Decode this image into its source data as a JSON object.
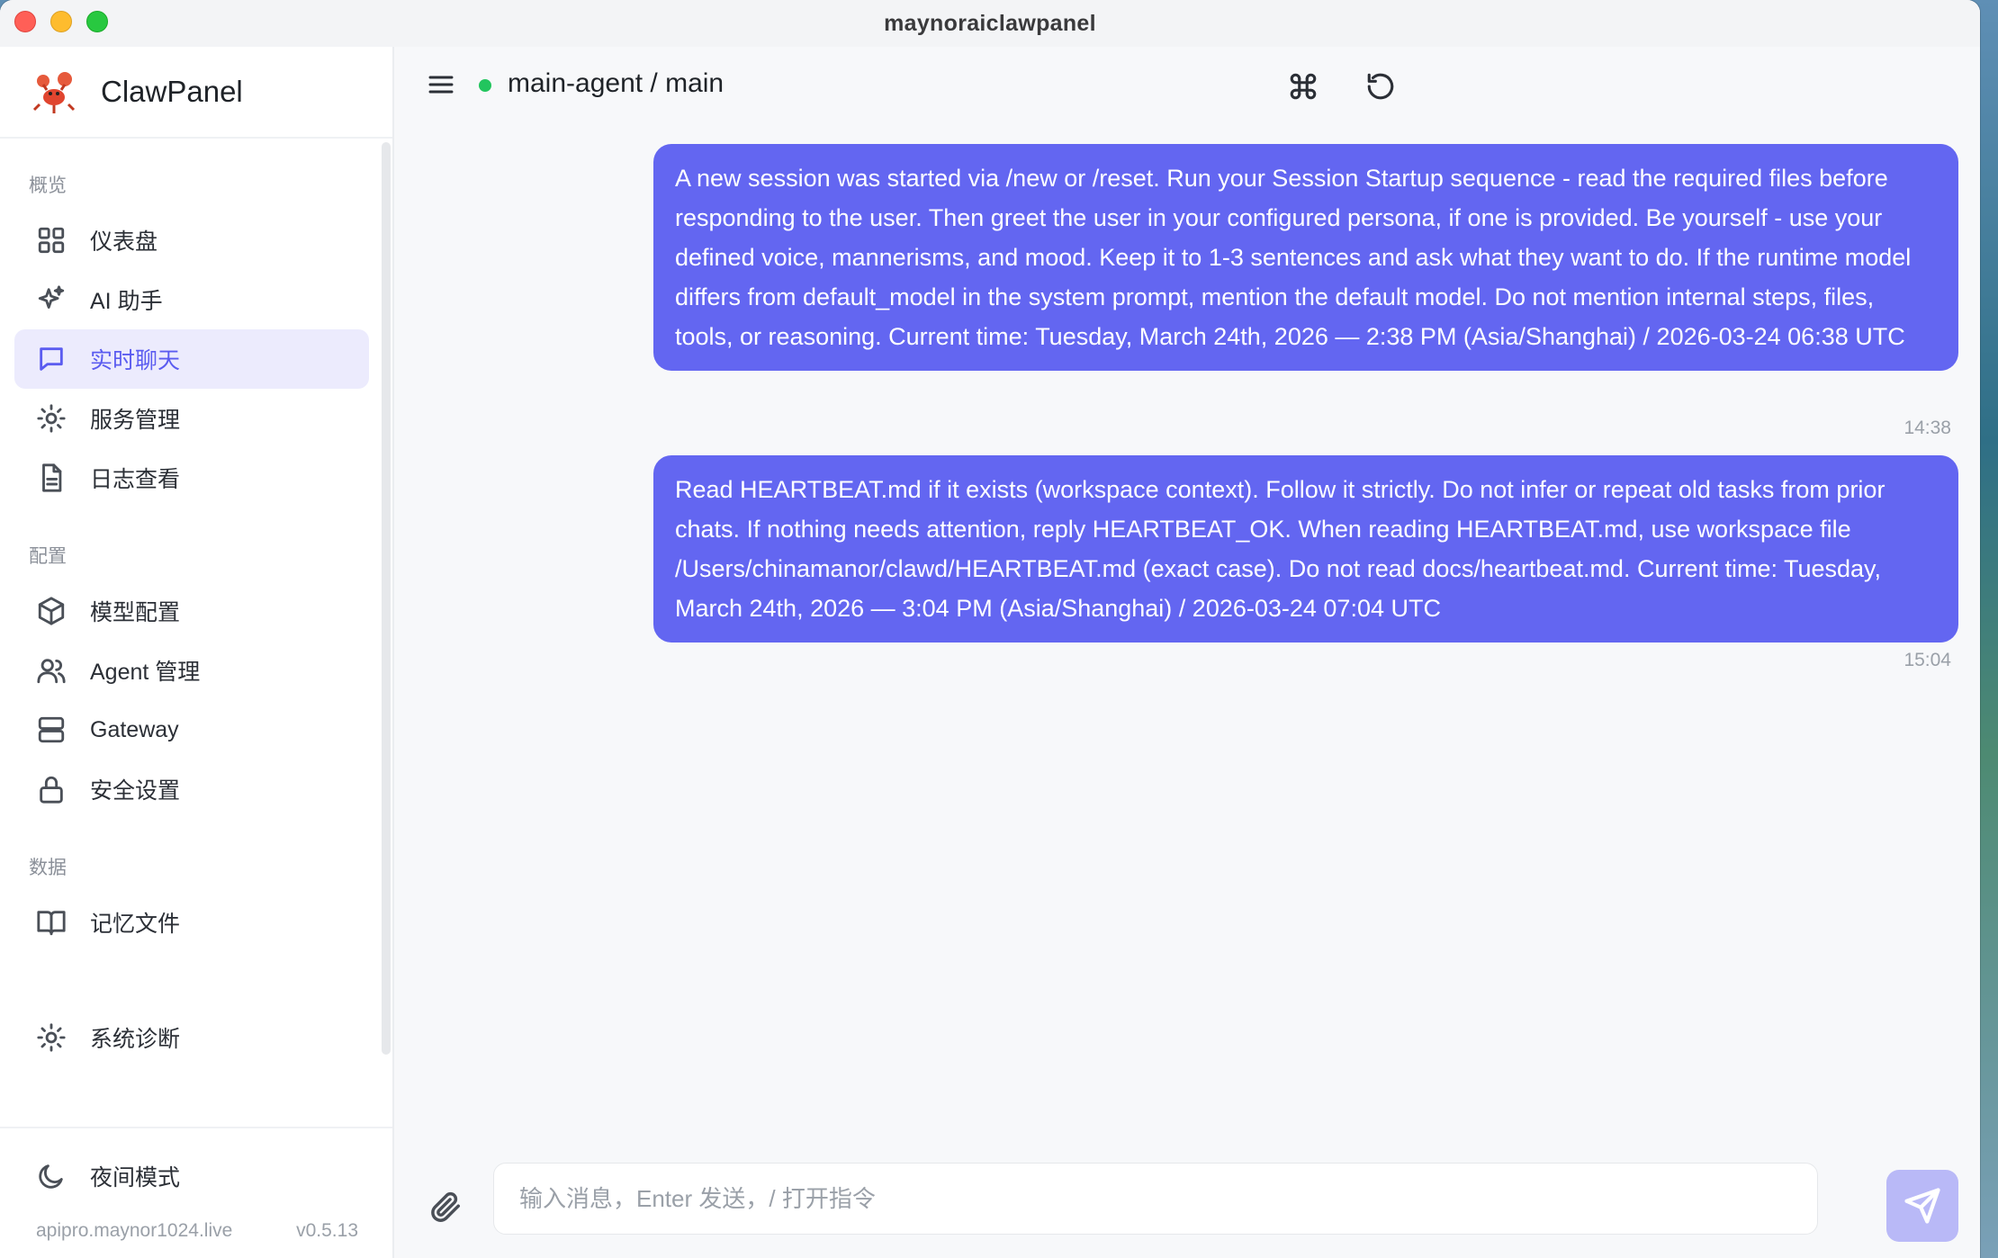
{
  "window": {
    "title": "maynoraiclawpanel"
  },
  "brand": {
    "name": "ClawPanel",
    "logo": "lobster-logo"
  },
  "sidebar": {
    "sections": [
      {
        "label": "概览",
        "items": [
          {
            "label": "仪表盘",
            "icon": "grid-icon"
          },
          {
            "label": "AI 助手",
            "icon": "sparkles-icon"
          },
          {
            "label": "实时聊天",
            "icon": "chat-bubble-icon",
            "active": true
          },
          {
            "label": "服务管理",
            "icon": "sun-gear-icon"
          },
          {
            "label": "日志查看",
            "icon": "document-icon"
          }
        ]
      },
      {
        "label": "配置",
        "items": [
          {
            "label": "模型配置",
            "icon": "cube-icon"
          },
          {
            "label": "Agent 管理",
            "icon": "users-icon"
          },
          {
            "label": "Gateway",
            "icon": "server-icon"
          },
          {
            "label": "安全设置",
            "icon": "lock-icon"
          }
        ]
      },
      {
        "label": "数据",
        "items": [
          {
            "label": "记忆文件",
            "icon": "book-icon"
          }
        ]
      }
    ],
    "diagnostics": {
      "label": "系统诊断",
      "icon": "sun-gear-icon"
    },
    "night_mode": {
      "label": "夜间模式",
      "icon": "moon-icon"
    },
    "footer": {
      "host": "apipro.maynor1024.live",
      "version": "v0.5.13"
    }
  },
  "chat": {
    "session_title": "main-agent / main",
    "status_color": "#22c55e",
    "messages": [
      {
        "role": "user",
        "text": "A new session was started via /new or /reset. Run your Session Startup sequence - read the required files before responding to the user. Then greet the user in your configured persona, if one is provided. Be yourself - use your defined voice, mannerisms, and mood. Keep it to 1-3 sentences and ask what they want to do. If the runtime model differs from default_model in the system prompt, mention the default model. Do not mention internal steps, files, tools, or reasoning. Current time: Tuesday, March 24th, 2026 — 2:38 PM (Asia/Shanghai) / 2026-03-24 06:38 UTC",
        "time": "14:38"
      },
      {
        "role": "user",
        "text": "Read HEARTBEAT.md if it exists (workspace context). Follow it strictly. Do not infer or repeat old tasks from prior chats. If nothing needs attention, reply HEARTBEAT_OK. When reading HEARTBEAT.md, use workspace file /Users/chinamanor/clawd/HEARTBEAT.md (exact case). Do not read docs/heartbeat.md. Current time: Tuesday, March 24th, 2026 — 3:04 PM (Asia/Shanghai) / 2026-03-24 07:04 UTC",
        "time": "15:04"
      }
    ],
    "composer": {
      "placeholder": "输入消息，Enter 发送，/ 打开指令",
      "value": ""
    }
  },
  "colors": {
    "accent": "#6366f1",
    "active_nav_bg": "#ecebfd",
    "send_disabled": "#b9b9f7"
  }
}
